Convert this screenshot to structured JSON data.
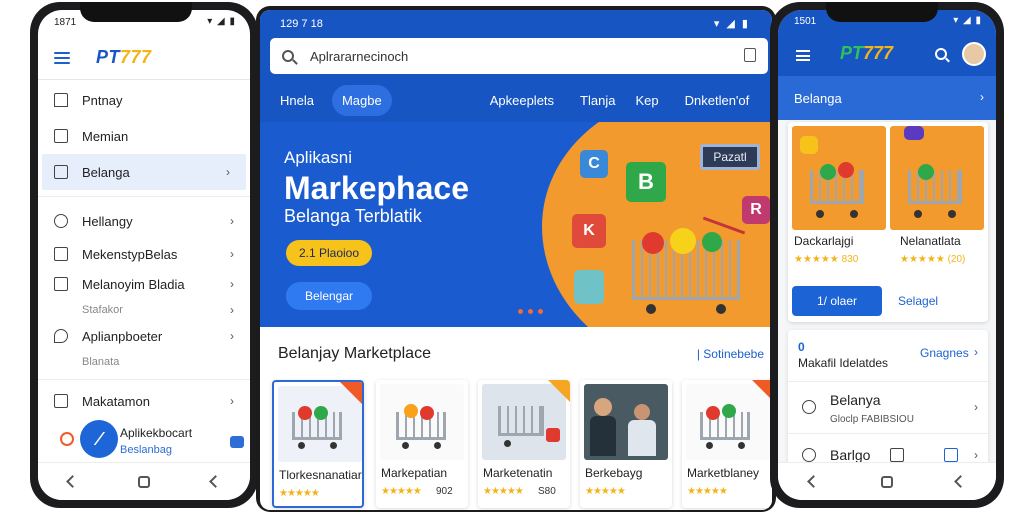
{
  "left_phone": {
    "status_time": "1871",
    "status_icons": "▾ ◢ ▮",
    "brand": {
      "part1": "PT",
      "part2": "777"
    },
    "menu": [
      {
        "label": "Pntnay"
      },
      {
        "label": "Memian"
      },
      {
        "label": "Belanga"
      },
      {
        "label": "Hellangy"
      },
      {
        "label": "MekenstypBelas"
      },
      {
        "label": "Melanoyim Bladia"
      }
    ],
    "sub_1": "Stafakor",
    "menu_2": [
      {
        "label": "Aplianpboeter"
      }
    ],
    "sub_2": "Blanata",
    "menu_3": [
      {
        "label": "Makatamon"
      }
    ],
    "app": {
      "name": "Aplikekbocart",
      "sub": "Beslanbag"
    }
  },
  "center_tablet": {
    "status_time": "129 7 18",
    "status_icons": "▾ ◢ ▮",
    "search": {
      "value": "Aplrararnecinoch"
    },
    "tabs": [
      "Hnela",
      "Magbe",
      "Apkeeplets",
      "Tlanja",
      "Kep",
      "Dnketlen'of"
    ],
    "hero": {
      "kicker": "Aplikasni",
      "title": "Markephace",
      "subtitle": "Belanga Terblatik",
      "pill": "2.1 Plaoioo",
      "cta": "Belengar",
      "sign": "Pazatl",
      "cube_letters": [
        "C",
        "B",
        "K",
        "R"
      ]
    },
    "section_title": "Belanjay Marketplace",
    "section_link": "| Sotinebebe",
    "products": [
      {
        "name": "Tlorkesnanatiar",
        "stars": "★★★★★",
        "rating": ""
      },
      {
        "name": "Markepatian",
        "stars": "★★★★★",
        "rating": "902"
      },
      {
        "name": "Marketenatin",
        "stars": "★★★★★",
        "rating": "S80"
      },
      {
        "name": "Berkebayg",
        "stars": "★★★★★",
        "rating": ""
      },
      {
        "name": "Marketblaney",
        "stars": "★★★★★",
        "rating": ""
      }
    ]
  },
  "right_phone": {
    "status_time": "1501",
    "status_icons": "▾ ◢ ▮",
    "brand": {
      "part1": "PT",
      "part2": "777"
    },
    "tab_label": "Belanga",
    "products": [
      {
        "name": "Dackarlajgi",
        "stars": "★★★★★ 830",
        "action": "1/ olaer"
      },
      {
        "name": "Nelanatlata",
        "stars": "★★★★★ (20)",
        "action": "Selagel"
      }
    ],
    "list": {
      "header_title": "Makafil Idelatdes",
      "header_badge": "0",
      "header_link": "Gnagnes",
      "row1_title": "Belanya",
      "row1_sub": "Gloclp FABIBSIOU",
      "row2_title": "Barlgo"
    }
  },
  "colors": {
    "primary": "#1756c2",
    "accent": "#f3b416",
    "orange": "#f29a2e"
  }
}
